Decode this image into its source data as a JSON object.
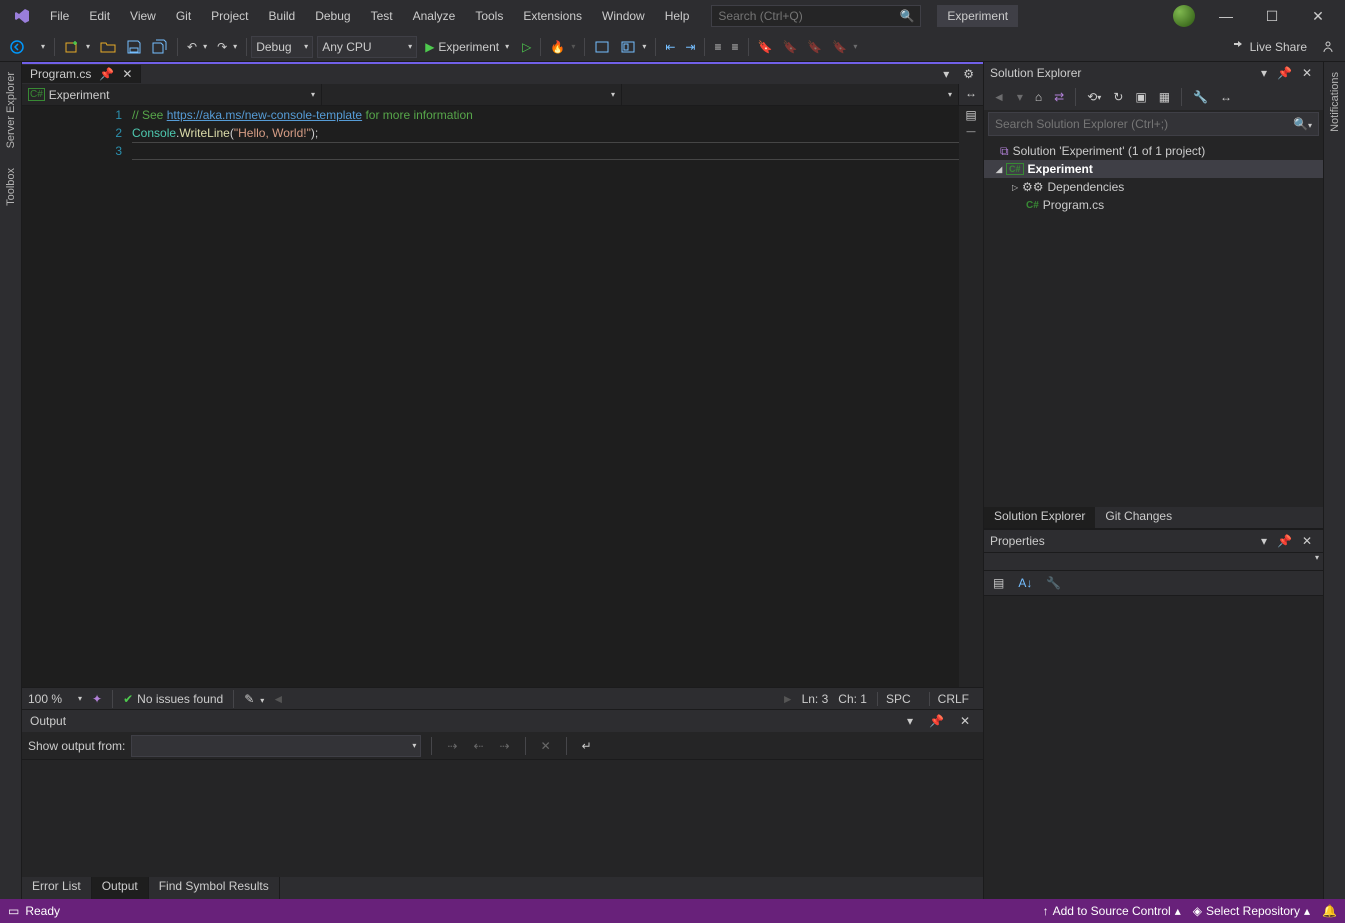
{
  "menu": [
    "File",
    "Edit",
    "View",
    "Git",
    "Project",
    "Build",
    "Debug",
    "Test",
    "Analyze",
    "Tools",
    "Extensions",
    "Window",
    "Help"
  ],
  "search_placeholder": "Search (Ctrl+Q)",
  "app_name": "Experiment",
  "live_share": "Live Share",
  "toolbar": {
    "config": "Debug",
    "platform": "Any CPU",
    "start": "Experiment"
  },
  "left_rail": [
    "Server Explorer",
    "Toolbox"
  ],
  "right_rail": [
    "Notifications"
  ],
  "doc_tab": {
    "label": "Program.cs"
  },
  "nav_combo": {
    "left": "Experiment"
  },
  "code": {
    "lines": [
      "1",
      "2",
      "3"
    ],
    "comment_prefix": "// See ",
    "url": "https://aka.ms/new-console-template",
    "comment_suffix": " for more information",
    "console": "Console",
    "write": "WriteLine",
    "hello": "\"Hello, World!\""
  },
  "editor_status": {
    "zoom": "100 %",
    "issues": "No issues found",
    "ln": "Ln: 3",
    "ch": "Ch: 1",
    "spc": "SPC",
    "crlf": "CRLF"
  },
  "output": {
    "title": "Output",
    "show_from": "Show output from:"
  },
  "bottom_tabs": [
    "Error List",
    "Output",
    "Find Symbol Results"
  ],
  "solution_explorer": {
    "title": "Solution Explorer",
    "search_placeholder": "Search Solution Explorer (Ctrl+;)",
    "solution": "Solution 'Experiment' (1 of 1 project)",
    "project": "Experiment",
    "dependencies": "Dependencies",
    "file": "Program.cs",
    "tabs": [
      "Solution Explorer",
      "Git Changes"
    ]
  },
  "properties": {
    "title": "Properties"
  },
  "statusbar": {
    "ready": "Ready",
    "add_source": "Add to Source Control",
    "select_repo": "Select Repository"
  }
}
